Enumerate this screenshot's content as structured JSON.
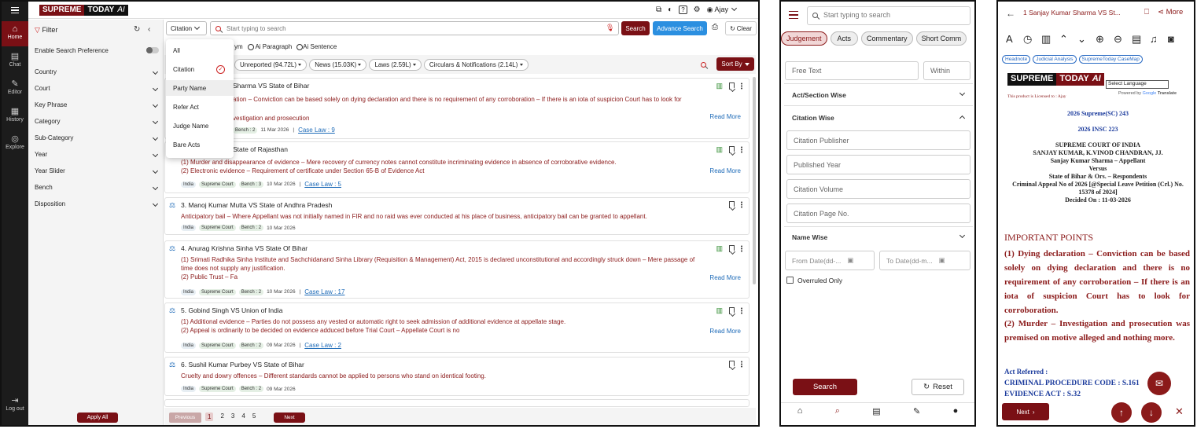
{
  "desktop": {
    "brand": {
      "part1": "SUPREME",
      "part2": "TODAY",
      "part3": "AI"
    },
    "user": "Ajay",
    "nav": [
      {
        "label": "Home",
        "icon": "home-icon"
      },
      {
        "label": "Chat",
        "icon": "chat-icon"
      },
      {
        "label": "Editor",
        "icon": "editor-icon"
      },
      {
        "label": "History",
        "icon": "history-icon"
      },
      {
        "label": "Explore",
        "icon": "explore-icon"
      }
    ],
    "logout": "Log out",
    "filter": {
      "title": "Filter",
      "pref": "Enable Search Preference",
      "items": [
        "Country",
        "Court",
        "Key Phrase",
        "Category",
        "Sub-Category",
        "Year",
        "Year Slider",
        "Bench",
        "Disposition"
      ],
      "apply": "Apply All"
    },
    "search": {
      "type_selected": "Citation",
      "placeholder": "Start typing to search",
      "search_btn": "Search",
      "advance_btn": "Advance Search",
      "clear_btn": "Clear"
    },
    "search_modes": {
      "partial": "ym",
      "para": "Ai Paragraph",
      "sentence": "Ai Sentence"
    },
    "dropdown": [
      "All",
      "Citation",
      "Party Name",
      "Refer Act",
      "Judge Name",
      "Bare Acts"
    ],
    "filter_pills": [
      "Unreported (94.72L)",
      "News (15.03K)",
      "Laws (2.59L)",
      "Circulars & Notifications (2.14L)"
    ],
    "sort": "Sort By",
    "results": [
      {
        "title": "Sharma VS State of Bihar",
        "lines": [
          "ation – Conviction can be based solely on dying declaration and there is no requirement of any corroboration – If there is an iota of suspicion Court has to look for",
          "",
          "vestigation and prosecution"
        ],
        "tags": [
          "Bench : 2"
        ],
        "date": "11 Mar 2026",
        "caselaw": "Case Law : 9",
        "read_more": "Read More"
      },
      {
        "title": "State of Rajasthan",
        "lines": [
          "(1) Murder and disappearance of evidence – Mere recovery of currency notes cannot constitute incriminating evidence in absence of corroborative evidence.",
          "(2) Electronic evidence – Requirement of certificate under Section 65-B of Evidence Act"
        ],
        "tags": [
          "India",
          "Supreme Court",
          "Bench : 3"
        ],
        "date": "10 Mar 2026",
        "caselaw": "Case Law : 5",
        "read_more": "Read More"
      },
      {
        "title": "3. Manoj Kumar Mutta VS State of Andhra Pradesh",
        "lines": [
          "Anticipatory bail – Where Appellant was not initially named in FIR and no raid was ever conducted at his place of business, anticipatory bail can be granted to appellant."
        ],
        "tags": [
          "India",
          "Supreme Court",
          "Bench : 2"
        ],
        "date": "10 Mar 2026"
      },
      {
        "title": "4. Anurag Krishna Sinha VS State Of Bihar",
        "lines": [
          "(1) Srimati Radhika Sinha Institute and Sachchidanand Sinha Library (Requisition & Management) Act, 2015 is declared unconstitutional and accordingly struck down – Mere passage of",
          "time does not supply any justification.",
          "(2) Public Trust – Fa"
        ],
        "tags": [
          "India",
          "Supreme Court",
          "Bench : 2"
        ],
        "date": "10 Mar 2026",
        "caselaw": "Case Law : 17",
        "read_more": "Read More"
      },
      {
        "title": "5. Gobind Singh VS Union of India",
        "lines": [
          "(1) Additional evidence – Parties do not possess any vested or automatic right to seek admission of additional evidence at appellate stage.",
          "(2) Appeal is ordinarily to be decided on evidence adduced before Trial Court – Appellate Court is no"
        ],
        "tags": [
          "India",
          "Supreme Court",
          "Bench : 2"
        ],
        "date": "09 Mar 2026",
        "caselaw": "Case Law : 2",
        "read_more": "Read More"
      },
      {
        "title": "6. Sushil Kumar Purbey VS State of Bihar",
        "lines": [
          "Cruelty and dowry offences – Different standards cannot be applied to persons who stand on identical footing."
        ],
        "tags": [
          "India",
          "Supreme Court",
          "Bench : 2"
        ],
        "date": "09 Mar 2026"
      }
    ],
    "pagination": {
      "prev": "Previous",
      "pages": [
        "1",
        "2",
        "3",
        "4",
        "5"
      ],
      "next": "Next"
    }
  },
  "mobile_filter": {
    "placeholder": "Start typing to search",
    "tabs": [
      "Judgement",
      "Acts",
      "Commentary",
      "Short Comm"
    ],
    "free_text": "Free Text",
    "within": "Within",
    "act_section": "Act/Section Wise",
    "citation_wise": "Citation Wise",
    "citation_fields": [
      "Citation Publisher",
      "Published Year",
      "Citation Volume",
      "Citation Page No."
    ],
    "name_wise": "Name Wise",
    "from_date": "From Date(dd-...",
    "to_date": "To Date(dd-m...",
    "overruled": "Overruled Only",
    "search": "Search",
    "reset": "Reset"
  },
  "mobile_doc": {
    "title": "Sanjay Kumar Sharma VS St...",
    "more": "More",
    "chips": [
      "Headnote",
      "Judicial Analysis",
      "SupremeToday CaseMap"
    ],
    "select_language": "Select Language",
    "powered": "Powered by",
    "translate": "Translate",
    "licensed": "This product is Licensed to : Ajay",
    "citation1": "2026 Supreme(SC) 243",
    "citation2": "2026 INSC 223",
    "court": "SUPREME COURT OF INDIA",
    "judges": "SANJAY KUMAR, K.VINOD CHANDRAN, JJ.",
    "appellant": "Sanjay Kumar Sharma – Appellant",
    "versus": "Versus",
    "respondent": "State of Bihar & Ors. – Respondents",
    "appeal": "Criminal Appeal No of 2026 [@Special Leave Petition (Crl.) No. 15378 of 2024]",
    "decided": "Decided On : 11-03-2026",
    "points_title": "IMPORTANT POINTS",
    "points": "(1) Dying declaration – Conviction can be based solely on dying declaration and there is no requirement of any corroboration – If there is an iota of suspicion Court has to look for corroboration.",
    "points2": "(2) Murder – Investigation and prosecution was premised on motive alleged and nothing more.",
    "act_ref": "Act Referred :",
    "act1": "CRIMINAL PROCEDURE CODE : S.161",
    "act2": "EVIDENCE ACT : S.32",
    "next": "Next"
  }
}
